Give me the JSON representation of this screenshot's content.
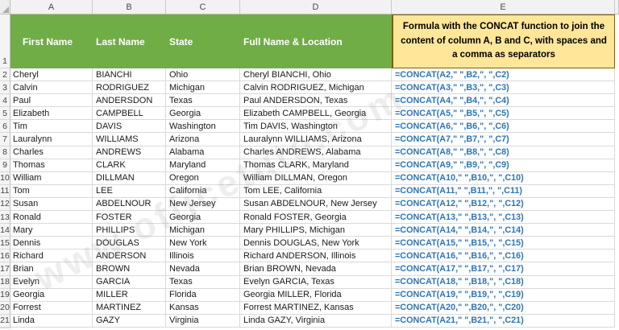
{
  "watermark": "www.officetuto.com",
  "column_strip": {
    "letters": [
      "A",
      "B",
      "C",
      "D",
      "E"
    ]
  },
  "header_row": {
    "first_name": "First Name",
    "last_name": "Last Name",
    "state": "State",
    "full_name": "Full Name & Location",
    "note": "Formula with the CONCAT function to join the content of column A, B and C, with spaces and a comma as separators"
  },
  "colors": {
    "header_green": "#70AD47",
    "header_text": "#FFFFFF",
    "note_yellow": "#FFE699",
    "note_border": "#806000",
    "formula_blue": "#2E75B6",
    "gridline": "#D9D9D9"
  },
  "rows": [
    {
      "n": "2",
      "first": "Cheryl",
      "last": "BIANCHI",
      "state": "Ohio",
      "full": "Cheryl BIANCHI, Ohio",
      "formula": "=CONCAT(A2,\" \",B2,\", \",C2)"
    },
    {
      "n": "3",
      "first": "Calvin",
      "last": "RODRIGUEZ",
      "state": "Michigan",
      "full": "Calvin RODRIGUEZ, Michigan",
      "formula": "=CONCAT(A3,\" \",B3,\", \",C3)"
    },
    {
      "n": "4",
      "first": "Paul",
      "last": "ANDERSDON",
      "state": "Texas",
      "full": "Paul ANDERSDON, Texas",
      "formula": "=CONCAT(A4,\" \",B4,\", \",C4)"
    },
    {
      "n": "5",
      "first": "Elizabeth",
      "last": "CAMPBELL",
      "state": "Georgia",
      "full": "Elizabeth CAMPBELL, Georgia",
      "formula": "=CONCAT(A5,\" \",B5,\", \",C5)"
    },
    {
      "n": "6",
      "first": "Tim",
      "last": "DAVIS",
      "state": "Washington",
      "full": "Tim DAVIS, Washington",
      "formula": "=CONCAT(A6,\" \",B6,\", \",C6)"
    },
    {
      "n": "7",
      "first": "Lauralynn",
      "last": "WILLIAMS",
      "state": "Arizona",
      "full": "Lauralynn WILLIAMS, Arizona",
      "formula": "=CONCAT(A7,\" \",B7,\", \",C7)"
    },
    {
      "n": "8",
      "first": "Charles",
      "last": "ANDREWS",
      "state": "Alabama",
      "full": "Charles ANDREWS, Alabama",
      "formula": "=CONCAT(A8,\" \",B8,\", \",C8)"
    },
    {
      "n": "9",
      "first": "Thomas",
      "last": "CLARK",
      "state": "Maryland",
      "full": "Thomas CLARK, Maryland",
      "formula": "=CONCAT(A9,\" \",B9,\", \",C9)"
    },
    {
      "n": "10",
      "first": "William",
      "last": "DILLMAN",
      "state": "Oregon",
      "full": "William DILLMAN, Oregon",
      "formula": "=CONCAT(A10,\" \",B10,\", \",C10)"
    },
    {
      "n": "11",
      "first": "Tom",
      "last": "LEE",
      "state": "California",
      "full": "Tom LEE, California",
      "formula": "=CONCAT(A11,\" \",B11,\", \",C11)"
    },
    {
      "n": "12",
      "first": "Susan",
      "last": "ABDELNOUR",
      "state": "New Jersey",
      "full": "Susan ABDELNOUR, New Jersey",
      "formula": "=CONCAT(A12,\" \",B12,\", \",C12)"
    },
    {
      "n": "13",
      "first": "Ronald",
      "last": "FOSTER",
      "state": "Georgia",
      "full": "Ronald FOSTER, Georgia",
      "formula": "=CONCAT(A13,\" \",B13,\", \",C13)"
    },
    {
      "n": "14",
      "first": "Mary",
      "last": "PHILLIPS",
      "state": "Michigan",
      "full": "Mary PHILLIPS, Michigan",
      "formula": "=CONCAT(A14,\" \",B14,\", \",C14)"
    },
    {
      "n": "15",
      "first": "Dennis",
      "last": "DOUGLAS",
      "state": "New York",
      "full": "Dennis DOUGLAS, New York",
      "formula": "=CONCAT(A15,\" \",B15,\", \",C15)"
    },
    {
      "n": "16",
      "first": "Richard",
      "last": "ANDERSON",
      "state": "Illinois",
      "full": "Richard ANDERSON, Illinois",
      "formula": "=CONCAT(A16,\" \",B16,\", \",C16)"
    },
    {
      "n": "17",
      "first": "Brian",
      "last": "BROWN",
      "state": "Nevada",
      "full": "Brian BROWN, Nevada",
      "formula": "=CONCAT(A17,\" \",B17,\", \",C17)"
    },
    {
      "n": "18",
      "first": "Evelyn",
      "last": "GARCIA",
      "state": "Texas",
      "full": "Evelyn GARCIA, Texas",
      "formula": "=CONCAT(A18,\" \",B18,\", \",C18)"
    },
    {
      "n": "19",
      "first": "Georgia",
      "last": "MILLER",
      "state": "Florida",
      "full": "Georgia MILLER, Florida",
      "formula": "=CONCAT(A19,\" \",B19,\", \",C19)"
    },
    {
      "n": "20",
      "first": "Forrest",
      "last": "MARTINEZ",
      "state": "Kansas",
      "full": "Forrest MARTINEZ, Kansas",
      "formula": "=CONCAT(A20,\" \",B20,\", \",C20)"
    },
    {
      "n": "21",
      "first": "Linda",
      "last": "GAZY",
      "state": "Virginia",
      "full": "Linda GAZY, Virginia",
      "formula": "=CONCAT(A21,\" \",B21,\", \",C21)"
    }
  ]
}
